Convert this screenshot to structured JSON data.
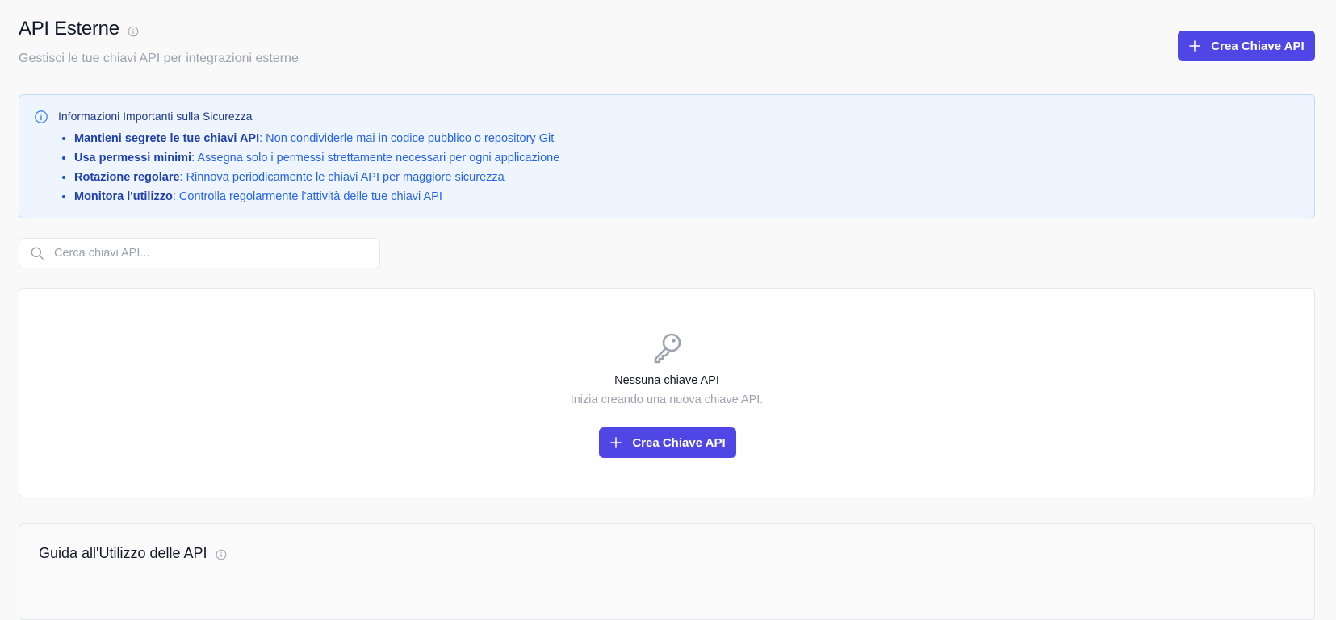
{
  "header": {
    "title": "API Esterne",
    "subtitle": "Gestisci le tue chiavi API per integrazioni esterne",
    "create_button_label": "Crea Chiave API"
  },
  "security_info": {
    "title": "Informazioni Importanti sulla Sicurezza",
    "items": [
      {
        "strong": "Mantieni segrete le tue chiavi API",
        "text": ": Non condividerle mai in codice pubblico o repository Git"
      },
      {
        "strong": "Usa permessi minimi",
        "text": ": Assegna solo i permessi strettamente necessari per ogni applicazione"
      },
      {
        "strong": "Rotazione regolare",
        "text": ": Rinnova periodicamente le chiavi API per maggiore sicurezza"
      },
      {
        "strong": "Monitora l'utilizzo",
        "text": ": Controlla regolarmente l'attività delle tue chiavi API"
      }
    ]
  },
  "search": {
    "placeholder": "Cerca chiavi API...",
    "value": ""
  },
  "empty_state": {
    "title": "Nessuna chiave API",
    "subtitle": "Inizia creando una nuova chiave API.",
    "button_label": "Crea Chiave API"
  },
  "guide": {
    "title": "Guida all'Utilizzo delle API"
  },
  "colors": {
    "primary": "#4f46e5",
    "info_background": "#eef5fe",
    "info_border": "#bfdbfe",
    "info_text": "#1d4ed8"
  },
  "icons": {
    "title_info": "info-icon",
    "create": "plus-icon",
    "security_info": "info-icon",
    "search": "search-icon",
    "empty_state": "key-icon",
    "guide_info": "info-icon"
  }
}
